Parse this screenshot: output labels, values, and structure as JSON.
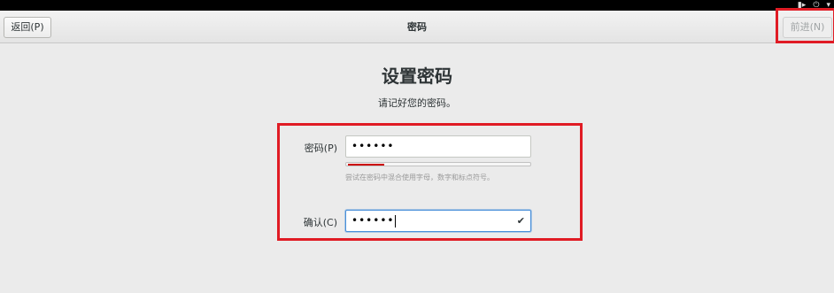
{
  "system_tray": {
    "icons": [
      "speaker-icon",
      "power-icon",
      "chevron-down-icon"
    ]
  },
  "header": {
    "back_label": "返回(P)",
    "title": "密码",
    "next_label": "前进(N)"
  },
  "main": {
    "title": "设置密码",
    "subtitle": "请记好您的密码。"
  },
  "form": {
    "password_label": "密码(P)",
    "password_value": "••••••",
    "strength_fraction": 0.2,
    "strength_color": "#cc0000",
    "hint": "尝试在密码中混合使用字母，数字和标点符号。",
    "confirm_label": "确认(C)",
    "confirm_value": "••••••",
    "confirm_check": "✔"
  },
  "annotations": {
    "highlight_color": "#e01b24"
  }
}
